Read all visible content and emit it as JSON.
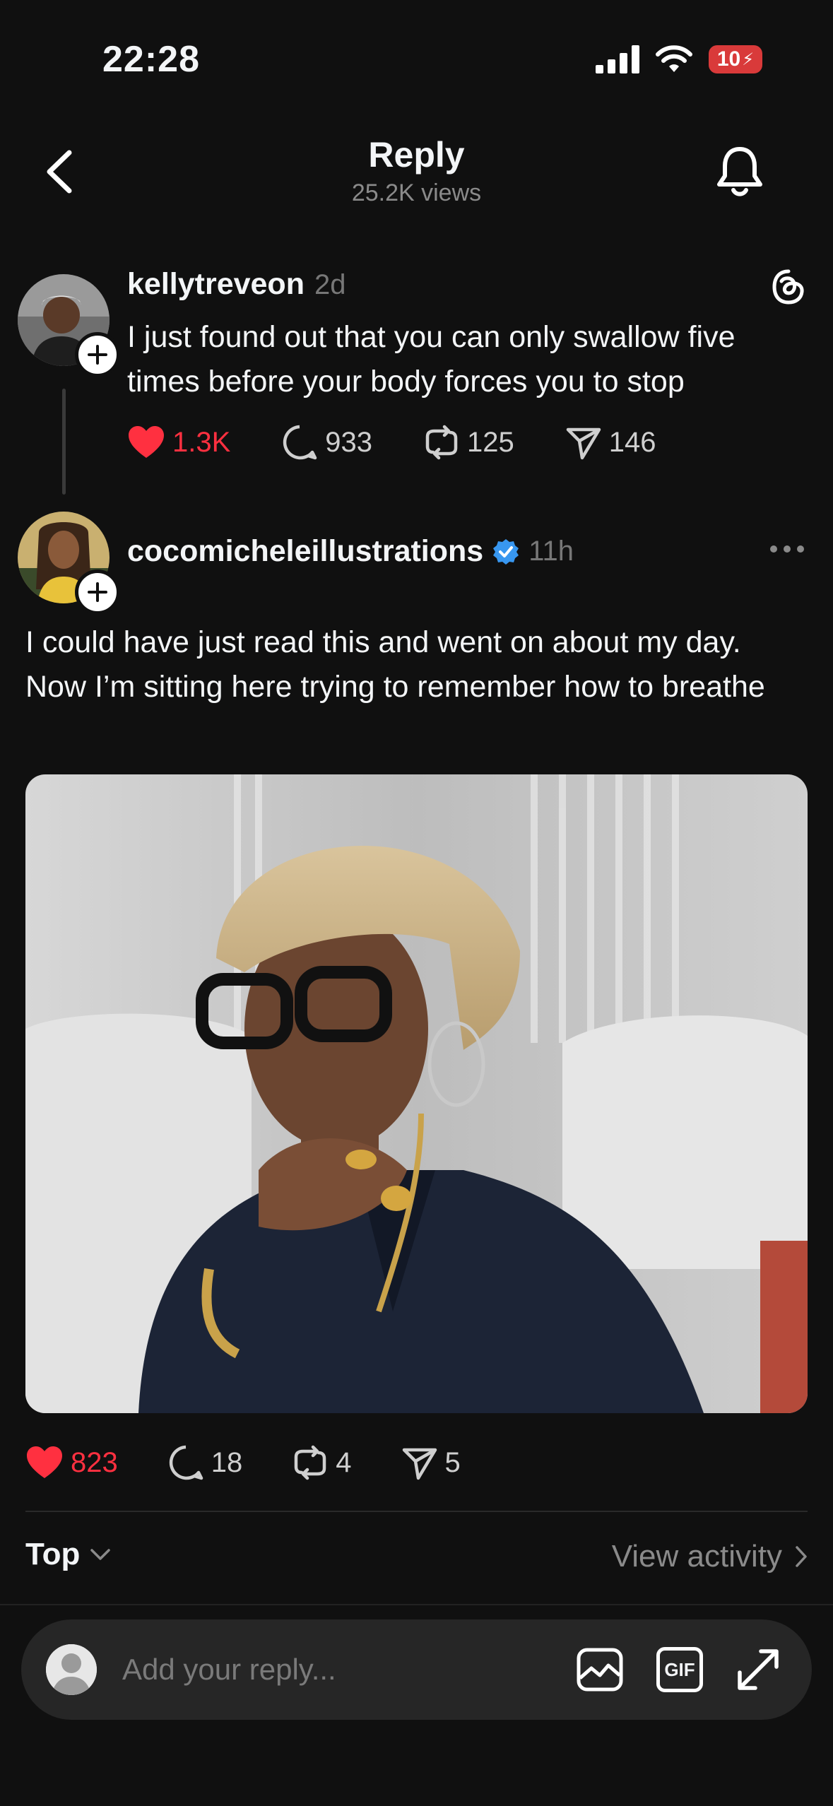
{
  "status_bar": {
    "time": "22:28",
    "battery": "10",
    "icons": [
      "signal-icon",
      "wifi-icon",
      "battery-icon"
    ]
  },
  "header": {
    "title": "Reply",
    "views": "25.2K views",
    "icons": [
      "back-icon",
      "bell-icon"
    ]
  },
  "parent_post": {
    "username": "kellytreveon",
    "time": "2d",
    "text": "I just found out that you can only swallow five times before your body forces you to stop",
    "likes": "1.3K",
    "comments": "933",
    "reposts": "125",
    "shares": "146",
    "liked": true
  },
  "reply_post": {
    "username": "cocomicheleillustrations",
    "verified": true,
    "time": "11h",
    "text": "I could have just read this and went on about my day. Now I’m sitting here trying to remember how to breathe",
    "likes": "823",
    "comments": "18",
    "reposts": "4",
    "shares": "5",
    "liked": true
  },
  "sort": {
    "label": "Top",
    "view_activity": "View activity"
  },
  "composer": {
    "placeholder": "Add your reply...",
    "gif_label": "GIF"
  },
  "colors": {
    "background": "#101010",
    "like": "#ff3040",
    "verified": "#3897f0"
  }
}
